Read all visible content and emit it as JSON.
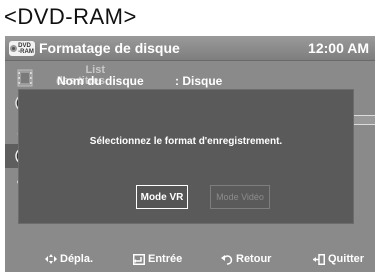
{
  "page": {
    "heading": "<DVD-RAM>"
  },
  "title_bar": {
    "badge_top": "DVD",
    "badge_bottom": "-RAM",
    "title": "Formatage de disque",
    "clock": "12:00 AM"
  },
  "sidebar": {
    "list_label_line1": "List",
    "list_label_line2": "des titres",
    "items": [
      {
        "icon": "film-icon"
      },
      {
        "icon": "disc-play-icon"
      },
      {
        "icon": "scissors-icon"
      },
      {
        "icon": "disc-settings-icon"
      },
      {
        "icon": "gear-icon"
      }
    ]
  },
  "background_row": {
    "label": "Nom du disque",
    "value": ": Disque"
  },
  "dialog": {
    "message": "Sélectionnez le format d'enregistrement.",
    "button_vr": "Mode VR",
    "button_video": "Mode Vidéo"
  },
  "footer": {
    "move": "Dépla.",
    "enter": "Entrée",
    "back": "Retour",
    "quit": "Quitter"
  },
  "colors": {
    "screen_bg": "#8a8a8a",
    "dialog_bg": "#5a5a5a",
    "text": "#ffffff"
  }
}
